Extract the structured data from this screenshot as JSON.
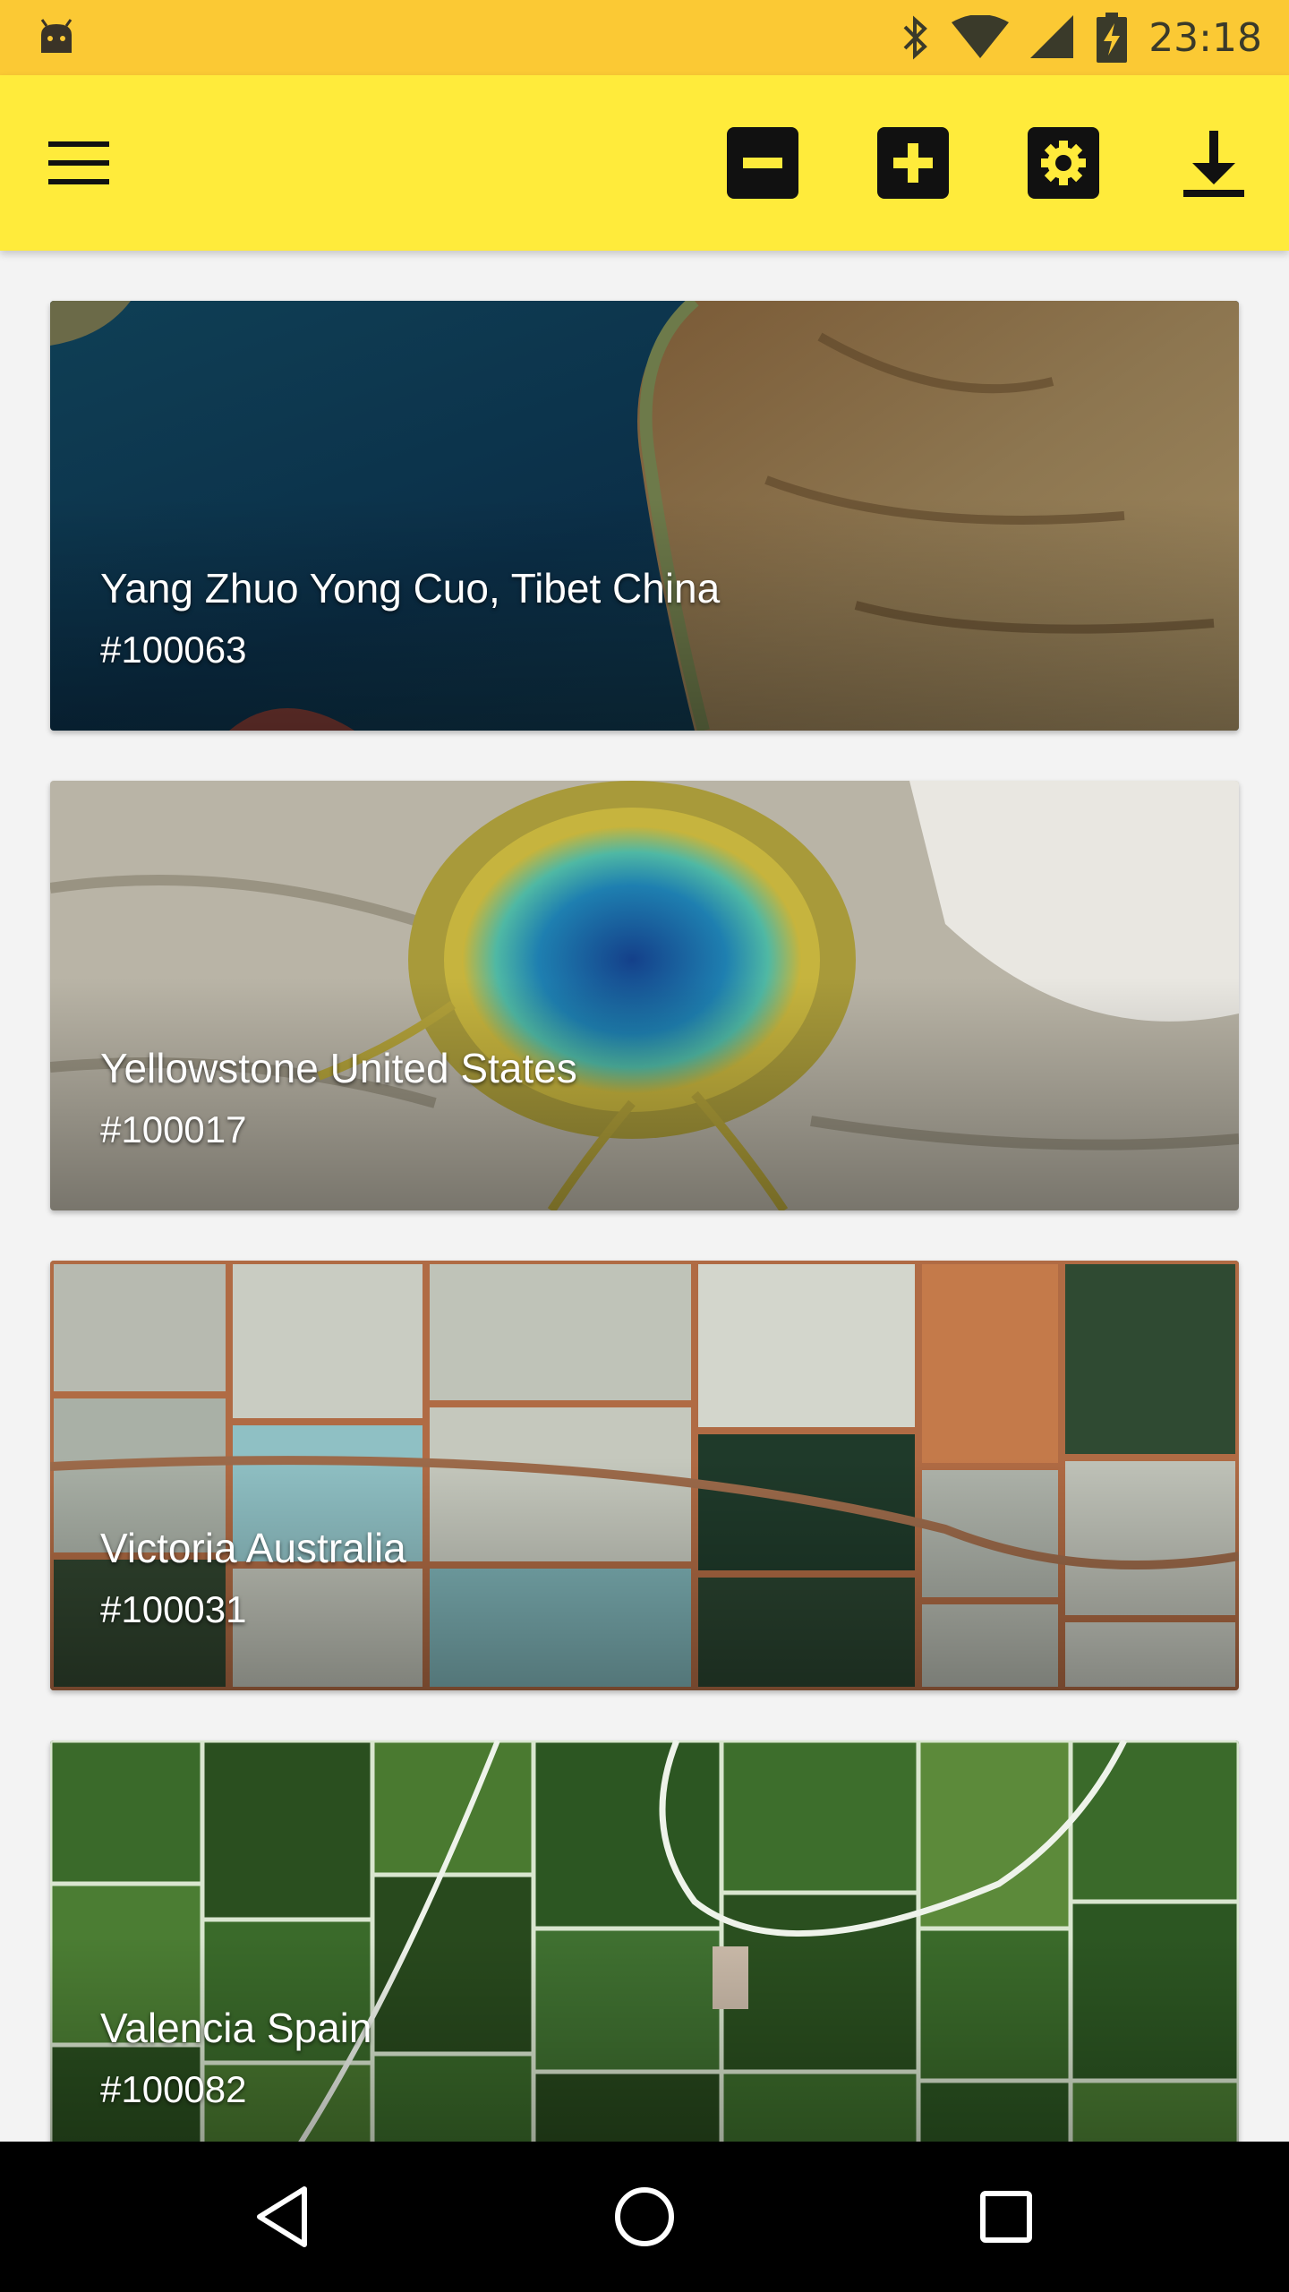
{
  "status_bar": {
    "time": "23:18",
    "icons": [
      "android-icon",
      "bluetooth-icon",
      "wifi-icon",
      "signal-icon",
      "battery-charging-icon"
    ],
    "background": "#fbc934"
  },
  "app_bar": {
    "background": "#ffeb3b",
    "icons": [
      "menu-icon",
      "zoom-out-icon",
      "zoom-in-icon",
      "settings-icon",
      "download-icon"
    ]
  },
  "cards": [
    {
      "title": "Yang Zhuo Yong Cuo, Tibet China",
      "id": "#100063"
    },
    {
      "title": "Yellowstone United States",
      "id": "#100017"
    },
    {
      "title": "Victoria Australia",
      "id": "#100031"
    },
    {
      "title": "Valencia Spain",
      "id": "#100082"
    }
  ],
  "nav_bar": {
    "icons": [
      "back-icon",
      "home-icon",
      "recents-icon"
    ]
  }
}
